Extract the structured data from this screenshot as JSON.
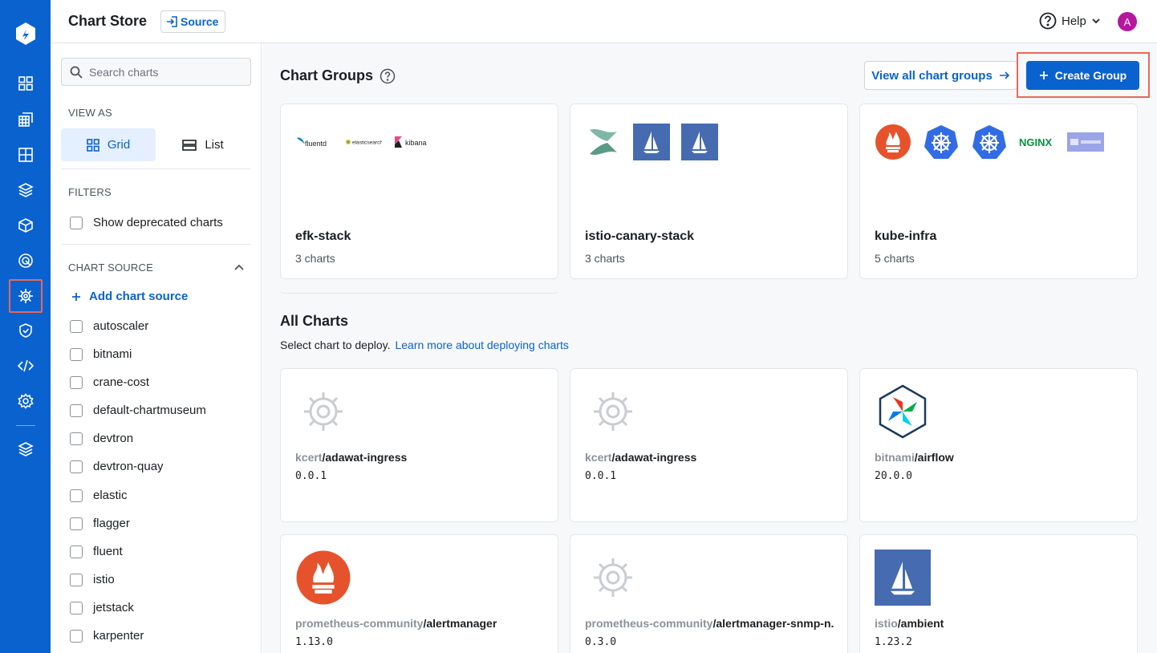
{
  "header": {
    "title": "Chart Store",
    "source_label": "Source",
    "help_label": "Help",
    "avatar_initial": "A"
  },
  "nav": {
    "items": [
      "overview-icon",
      "applications-icon",
      "grid-icon",
      "stack-icon",
      "box-icon",
      "target-icon",
      "helm-icon",
      "shield-icon",
      "code-icon",
      "settings-icon",
      "layers-icon"
    ],
    "active": "helm-icon",
    "accent": "#0a62cf",
    "highlight": "#e8685a"
  },
  "filters": {
    "search_placeholder": "Search charts",
    "view_as_label": "VIEW AS",
    "grid_label": "Grid",
    "list_label": "List",
    "filters_label": "FILTERS",
    "deprecated_label": "Show deprecated charts",
    "chart_source_label": "CHART SOURCE",
    "add_source_label": "Add chart source",
    "sources": [
      "autoscaler",
      "bitnami",
      "crane-cost",
      "default-chartmuseum",
      "devtron",
      "devtron-quay",
      "elastic",
      "flagger",
      "fluent",
      "istio",
      "jetstack",
      "karpenter"
    ]
  },
  "chart_groups": {
    "title": "Chart Groups",
    "view_all_label": "View all chart groups",
    "create_label": "Create Group",
    "groups": [
      {
        "name": "efk-stack",
        "count": "3 charts",
        "logos": [
          "fluentd",
          "elasticsearch",
          "kibana"
        ]
      },
      {
        "name": "istio-canary-stack",
        "count": "3 charts",
        "logos": [
          "flagger",
          "istio",
          "istio"
        ]
      },
      {
        "name": "kube-infra",
        "count": "5 charts",
        "logos": [
          "prometheus",
          "kubernetes",
          "kubernetes",
          "NGINX",
          "karpenter"
        ]
      }
    ]
  },
  "all_charts": {
    "title": "All Charts",
    "subtitle": "Select chart to deploy.",
    "learn_more": "Learn more about deploying charts",
    "charts": [
      {
        "repo": "kcert",
        "name": "/adawat-ingress",
        "version": "0.0.1",
        "icon": "helm-wheel-icon"
      },
      {
        "repo": "kcert",
        "name": "/adawat-ingress",
        "version": "0.0.1",
        "icon": "helm-wheel-icon"
      },
      {
        "repo": "bitnami",
        "name": "/airflow",
        "version": "20.0.0",
        "icon": "airflow-icon"
      },
      {
        "repo": "prometheus-community",
        "name": "/alertmanager",
        "version": "1.13.0",
        "icon": "prometheus-icon"
      },
      {
        "repo": "prometheus-community",
        "name": "/alertmanager-snmp-n...",
        "version": "0.3.0",
        "icon": "helm-wheel-icon"
      },
      {
        "repo": "istio",
        "name": "/ambient",
        "version": "1.23.2",
        "icon": "istio-icon"
      }
    ]
  }
}
